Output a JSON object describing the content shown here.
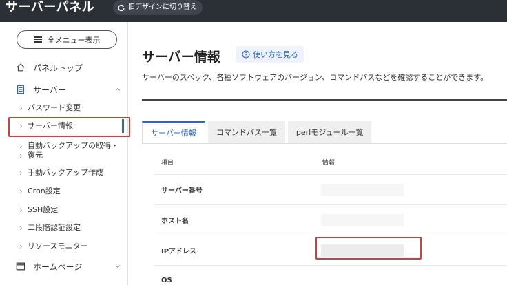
{
  "header": {
    "brand": "サーバーパネル",
    "old_design_label": "旧デザインに切り替え"
  },
  "sidebar": {
    "all_menu_label": "全メニュー表示",
    "panel_top_label": "パネルトップ",
    "server_label": "サーバー",
    "homepage_label": "ホームページ",
    "items": [
      {
        "label": "パスワード変更"
      },
      {
        "label": "サーバー情報",
        "active": true
      },
      {
        "label": "自動バックアップの取得・"
      },
      {
        "label": "復元"
      },
      {
        "label": "手動バックアップ作成"
      },
      {
        "label": "Cron設定"
      },
      {
        "label": "SSH設定"
      },
      {
        "label": "二段階認証設定"
      },
      {
        "label": "リソースモニター"
      }
    ]
  },
  "main": {
    "title": "サーバー情報",
    "howto_label": "使い方を見る",
    "description": "サーバーのスペック、各種ソフトウェアのバージョン、コマンドパスなどを確認することができます。",
    "tabs": [
      {
        "label": "サーバー情報",
        "active": true
      },
      {
        "label": "コマンドパス一覧"
      },
      {
        "label": "perlモジュール一覧"
      }
    ],
    "table": {
      "col_item": "項目",
      "col_info": "情報",
      "rows": [
        {
          "label": "サーバー番号"
        },
        {
          "label": "ホスト名"
        },
        {
          "label": "IPアドレス"
        },
        {
          "label": "OS"
        }
      ]
    }
  },
  "colors": {
    "accent": "#2a64c6",
    "highlight": "#d63b3b",
    "topbar": "#2b2f36"
  }
}
